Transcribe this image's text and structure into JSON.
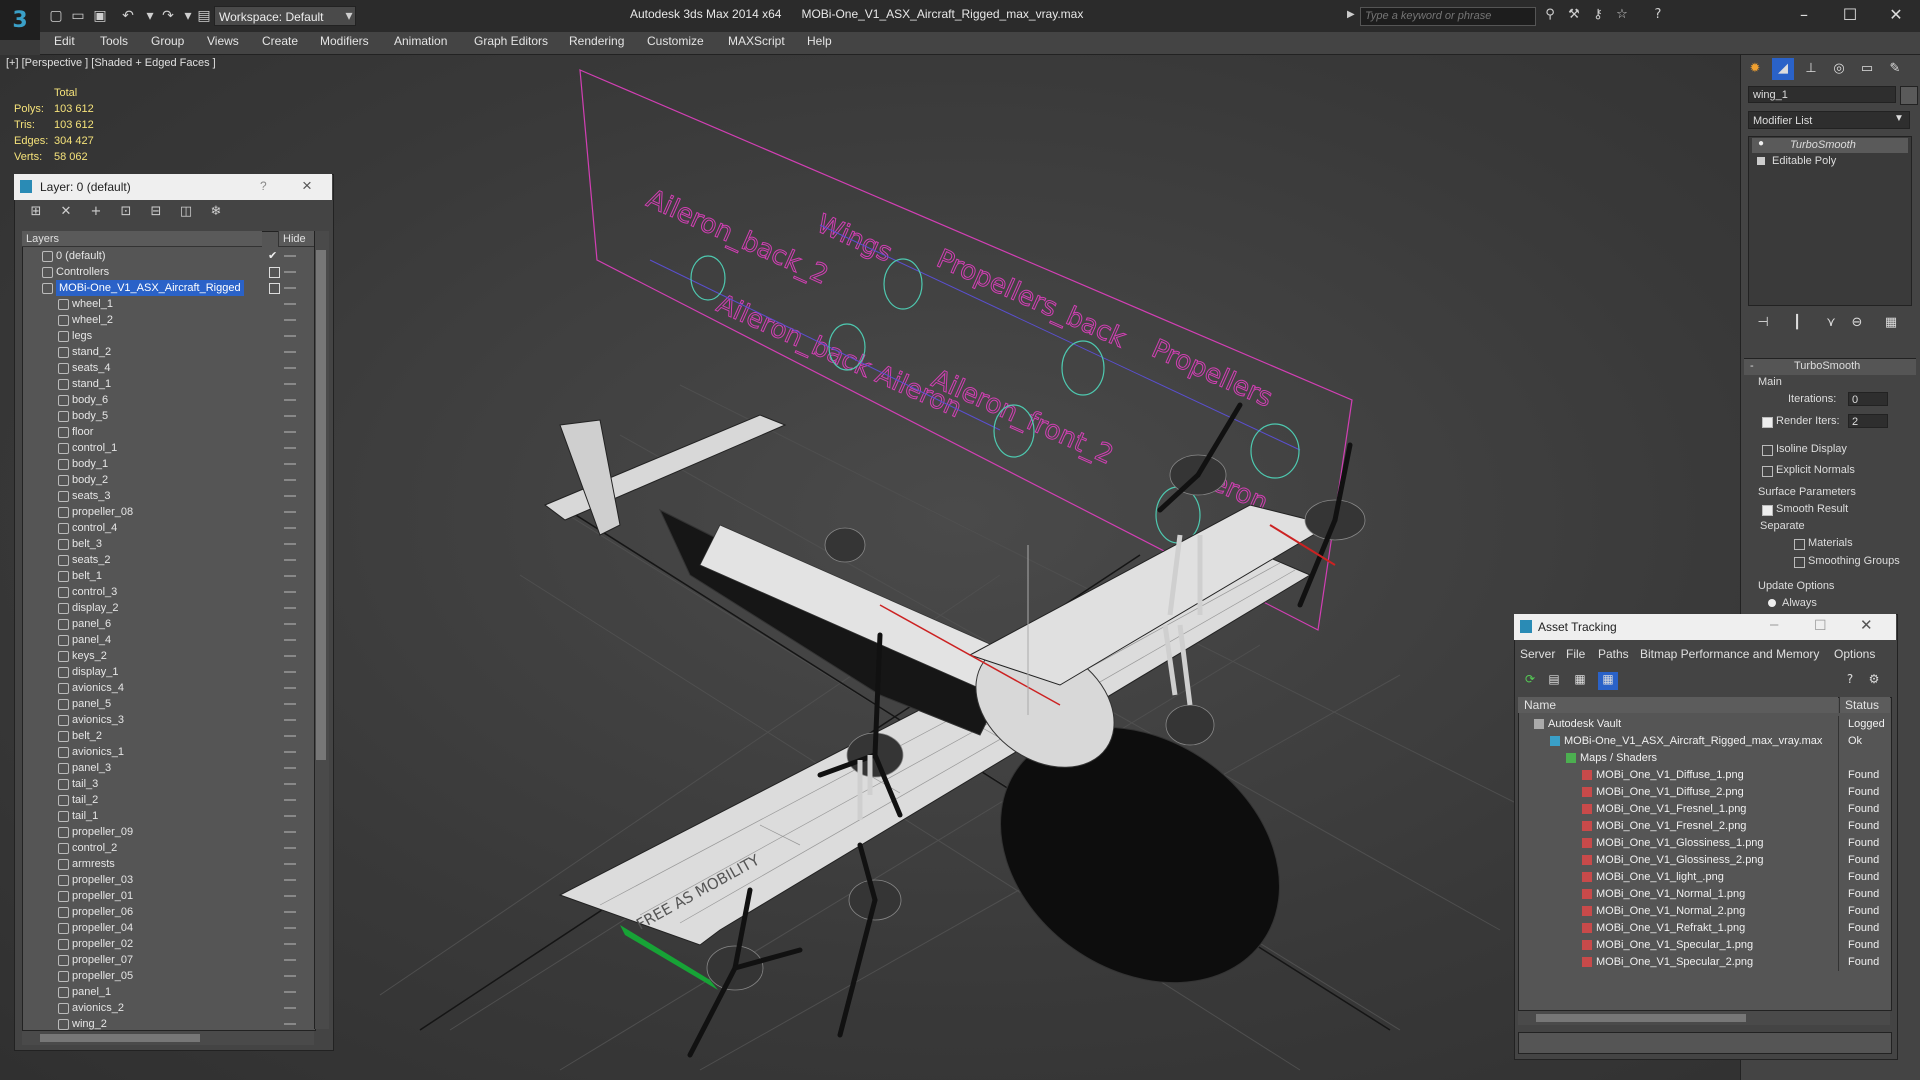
{
  "app": {
    "title": "Autodesk 3ds Max 2014 x64",
    "file": "MOBi-One_V1_ASX_Aircraft_Rigged_max_vray.max",
    "workspace": "Workspace: Default",
    "search_placeholder": "Type a keyword or phrase"
  },
  "menu": [
    "Edit",
    "Tools",
    "Group",
    "Views",
    "Create",
    "Modifiers",
    "Animation",
    "Graph Editors",
    "Rendering",
    "Customize",
    "MAXScript",
    "Help"
  ],
  "viewport": {
    "label": "[+] [Perspective ] [Shaded + Edged Faces ]",
    "stats_header": "Total",
    "stats": [
      {
        "label": "Polys:",
        "value": "103 612"
      },
      {
        "label": "Tris:",
        "value": "103 612"
      },
      {
        "label": "Edges:",
        "value": "304 427"
      },
      {
        "label": "Verts:",
        "value": "58 062"
      }
    ],
    "annotations": [
      "Wings",
      "Propellers_back",
      "Aileron_back_2",
      "Aileron_back Aileron",
      "Propellers",
      "Aileron_front_2",
      "Aileron_front",
      "Aileron"
    ],
    "wing_text": "FREE AS MOBILITY"
  },
  "layer_dialog": {
    "title": "Layer: 0 (default)",
    "help": "?",
    "close": "×",
    "col_layers": "Layers",
    "col_hide": "Hide",
    "rows": [
      {
        "name": "0 (default)",
        "level": 0,
        "type": "layer",
        "check": true
      },
      {
        "name": "Controllers",
        "level": 0,
        "type": "layer",
        "box": true
      },
      {
        "name": "MOBi-One_V1_ASX_Aircraft_Rigged",
        "level": 0,
        "type": "layer",
        "box": true,
        "selected": true
      },
      {
        "name": "wheel_1",
        "level": 1
      },
      {
        "name": "wheel_2",
        "level": 1
      },
      {
        "name": "legs",
        "level": 1
      },
      {
        "name": "stand_2",
        "level": 1
      },
      {
        "name": "seats_4",
        "level": 1
      },
      {
        "name": "stand_1",
        "level": 1
      },
      {
        "name": "body_6",
        "level": 1
      },
      {
        "name": "body_5",
        "level": 1
      },
      {
        "name": "floor",
        "level": 1
      },
      {
        "name": "control_1",
        "level": 1
      },
      {
        "name": "body_1",
        "level": 1
      },
      {
        "name": "body_2",
        "level": 1
      },
      {
        "name": "seats_3",
        "level": 1
      },
      {
        "name": "propeller_08",
        "level": 1
      },
      {
        "name": "control_4",
        "level": 1
      },
      {
        "name": "belt_3",
        "level": 1
      },
      {
        "name": "seats_2",
        "level": 1
      },
      {
        "name": "belt_1",
        "level": 1
      },
      {
        "name": "control_3",
        "level": 1
      },
      {
        "name": "display_2",
        "level": 1
      },
      {
        "name": "panel_6",
        "level": 1
      },
      {
        "name": "panel_4",
        "level": 1
      },
      {
        "name": "keys_2",
        "level": 1
      },
      {
        "name": "display_1",
        "level": 1
      },
      {
        "name": "avionics_4",
        "level": 1
      },
      {
        "name": "panel_5",
        "level": 1
      },
      {
        "name": "avionics_3",
        "level": 1
      },
      {
        "name": "belt_2",
        "level": 1
      },
      {
        "name": "avionics_1",
        "level": 1
      },
      {
        "name": "panel_3",
        "level": 1
      },
      {
        "name": "tail_3",
        "level": 1
      },
      {
        "name": "tail_2",
        "level": 1
      },
      {
        "name": "tail_1",
        "level": 1
      },
      {
        "name": "propeller_09",
        "level": 1
      },
      {
        "name": "control_2",
        "level": 1
      },
      {
        "name": "armrests",
        "level": 1
      },
      {
        "name": "propeller_03",
        "level": 1
      },
      {
        "name": "propeller_01",
        "level": 1
      },
      {
        "name": "propeller_06",
        "level": 1
      },
      {
        "name": "propeller_04",
        "level": 1
      },
      {
        "name": "propeller_02",
        "level": 1
      },
      {
        "name": "propeller_07",
        "level": 1
      },
      {
        "name": "propeller_05",
        "level": 1
      },
      {
        "name": "panel_1",
        "level": 1
      },
      {
        "name": "avionics_2",
        "level": 1
      },
      {
        "name": "wing_2",
        "level": 1
      }
    ]
  },
  "command_panel": {
    "object_name": "wing_1",
    "modifier_list": "Modifier List",
    "stack": [
      "TurboSmooth",
      "Editable Poly"
    ],
    "rollout_title": "TurboSmooth",
    "main": "Main",
    "iterations_label": "Iterations:",
    "iterations_value": "0",
    "render_iters_label": "Render Iters:",
    "render_iters_value": "2",
    "isoline": "Isoline Display",
    "explicit": "Explicit Normals",
    "surface_params": "Surface Parameters",
    "smooth_result": "Smooth Result",
    "separate": "Separate",
    "materials": "Materials",
    "smoothing_groups": "Smoothing Groups",
    "update_options": "Update Options",
    "always": "Always"
  },
  "asset_dialog": {
    "title": "Asset Tracking",
    "menu": [
      "Server",
      "File",
      "Paths",
      "Bitmap Performance and Memory",
      "Options"
    ],
    "col_name": "Name",
    "col_status": "Status",
    "rows": [
      {
        "name": "Autodesk Vault",
        "status": "Logged",
        "level": 0,
        "icon": "vault"
      },
      {
        "name": "MOBi-One_V1_ASX_Aircraft_Rigged_max_vray.max",
        "status": "Ok",
        "level": 1,
        "icon": "max"
      },
      {
        "name": "Maps / Shaders",
        "status": "",
        "level": 2,
        "icon": "maps"
      },
      {
        "name": "MOBi_One_V1_Diffuse_1.png",
        "status": "Found",
        "level": 3,
        "icon": "png"
      },
      {
        "name": "MOBi_One_V1_Diffuse_2.png",
        "status": "Found",
        "level": 3,
        "icon": "png"
      },
      {
        "name": "MOBi_One_V1_Fresnel_1.png",
        "status": "Found",
        "level": 3,
        "icon": "png"
      },
      {
        "name": "MOBi_One_V1_Fresnel_2.png",
        "status": "Found",
        "level": 3,
        "icon": "png"
      },
      {
        "name": "MOBi_One_V1_Glossiness_1.png",
        "status": "Found",
        "level": 3,
        "icon": "png"
      },
      {
        "name": "MOBi_One_V1_Glossiness_2.png",
        "status": "Found",
        "level": 3,
        "icon": "png"
      },
      {
        "name": "MOBi_One_V1_light_.png",
        "status": "Found",
        "level": 3,
        "icon": "png"
      },
      {
        "name": "MOBi_One_V1_Normal_1.png",
        "status": "Found",
        "level": 3,
        "icon": "png"
      },
      {
        "name": "MOBi_One_V1_Normal_2.png",
        "status": "Found",
        "level": 3,
        "icon": "png"
      },
      {
        "name": "MOBi_One_V1_Refrakt_1.png",
        "status": "Found",
        "level": 3,
        "icon": "png"
      },
      {
        "name": "MOBi_One_V1_Specular_1.png",
        "status": "Found",
        "level": 3,
        "icon": "png"
      },
      {
        "name": "MOBi_One_V1_Specular_2.png",
        "status": "Found",
        "level": 3,
        "icon": "png"
      }
    ]
  },
  "colors": {
    "selection": "#2a62c8",
    "stats": "#f5e27a",
    "annotation": "#d23fb4",
    "helper": "#4ec9b0"
  }
}
